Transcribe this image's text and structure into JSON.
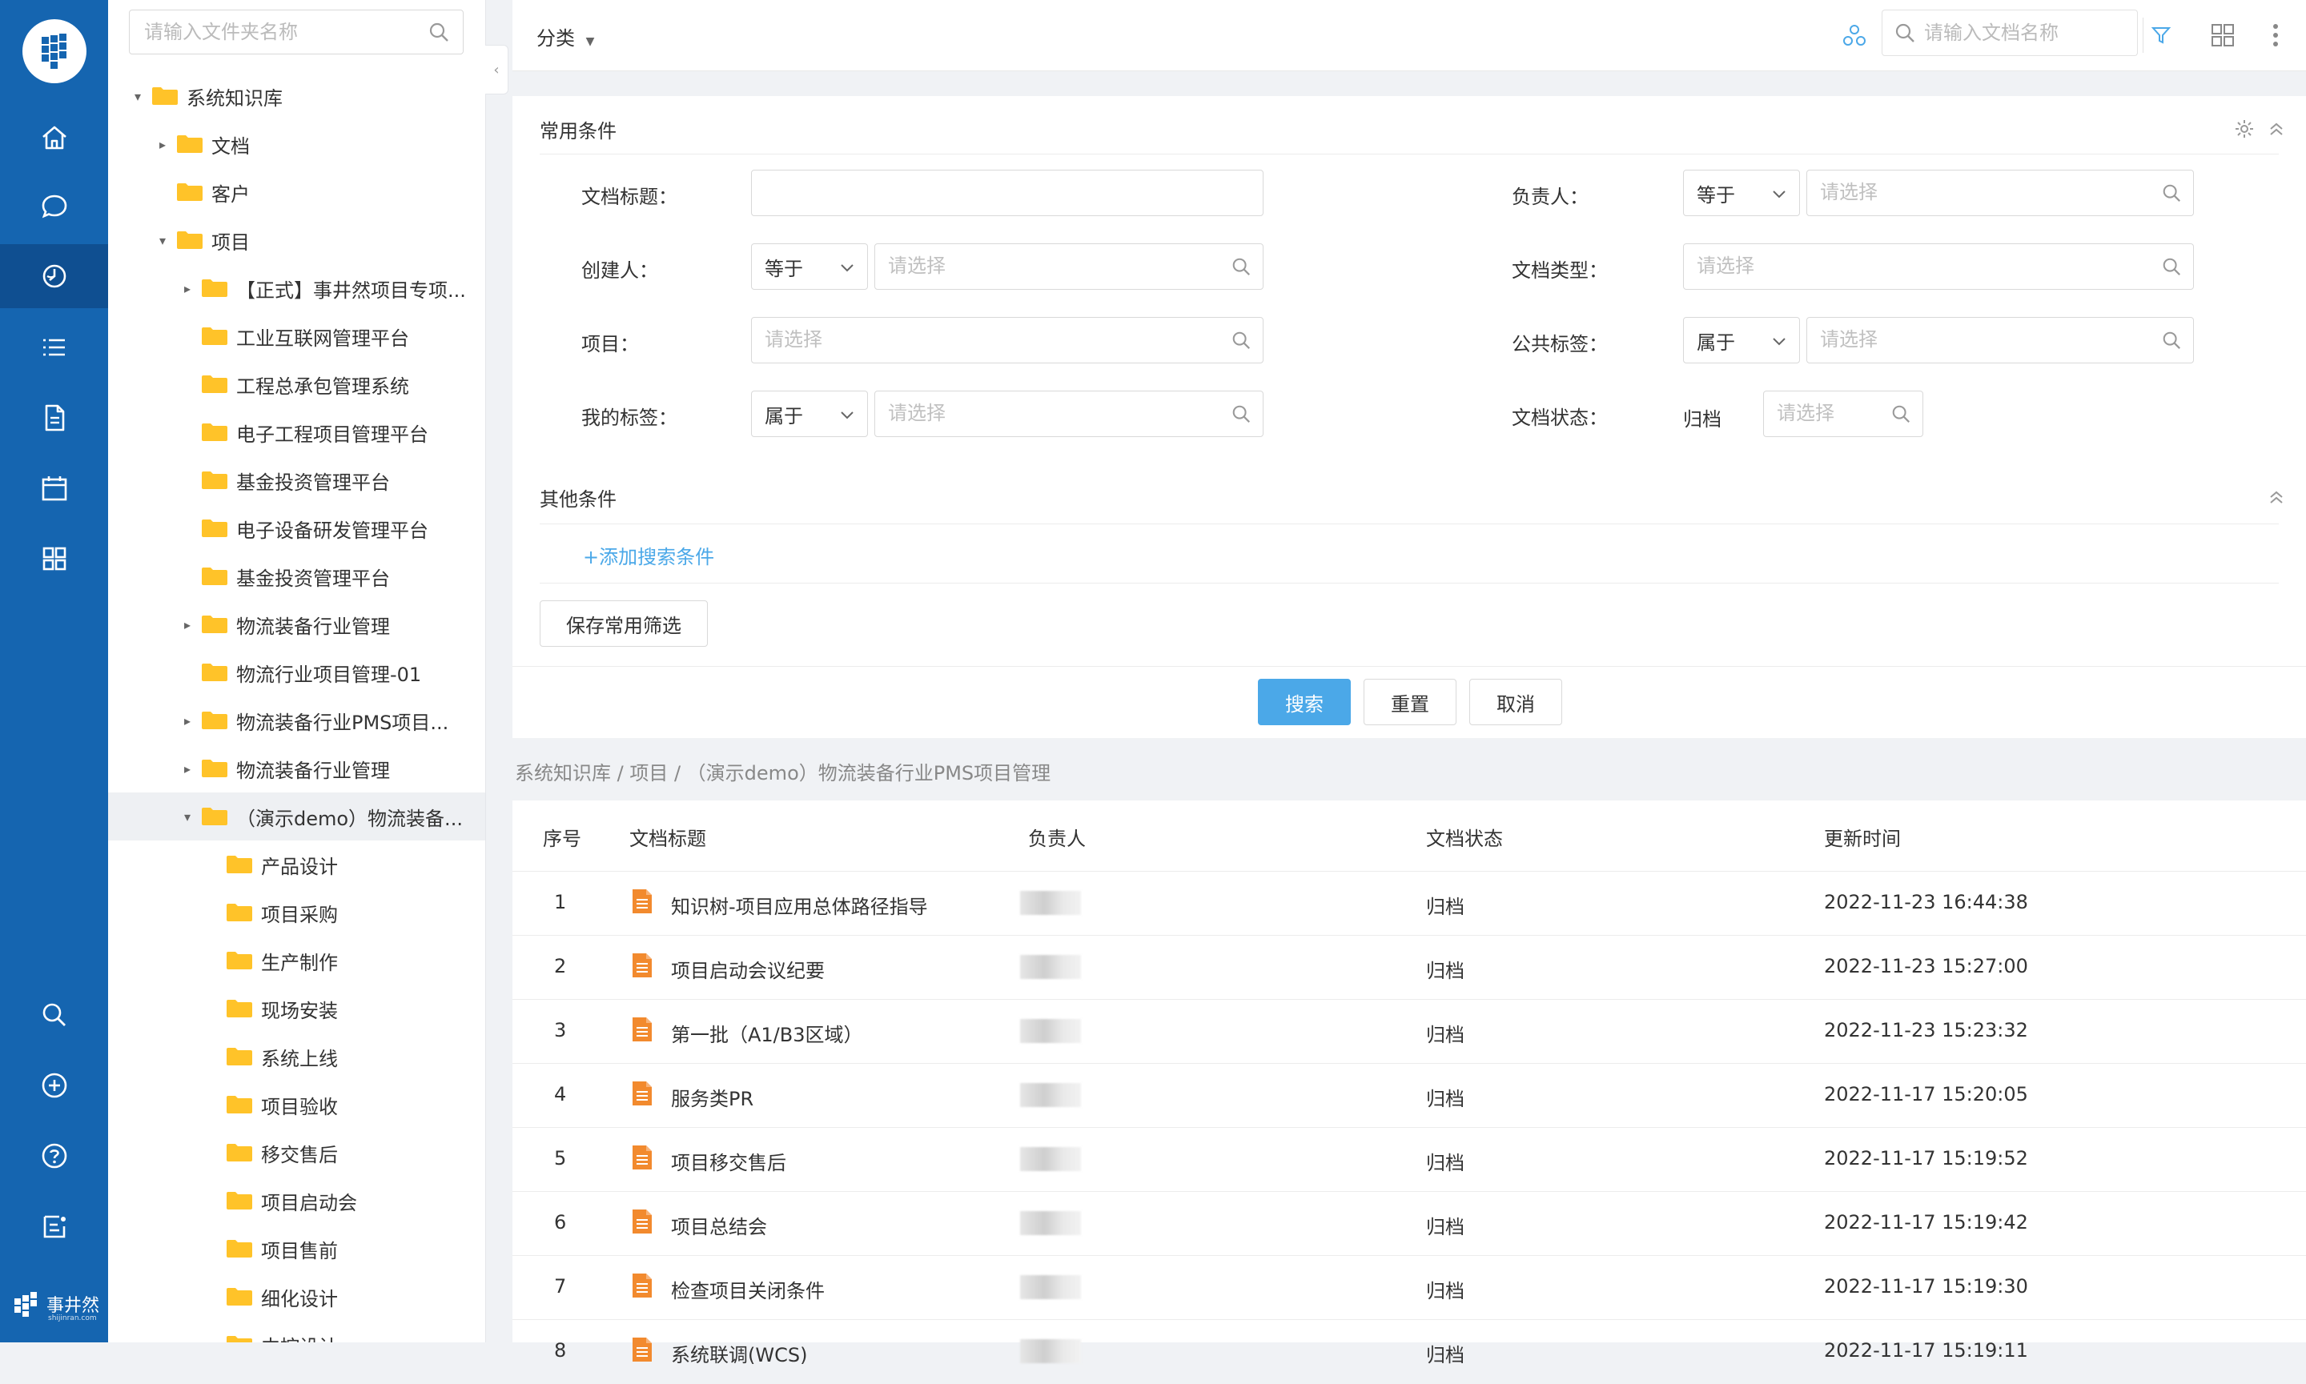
{
  "colors": {
    "rail": "#1565b0",
    "accent": "#4ba8e8",
    "folder": "#ffc329",
    "doc_icon": "#f28a2e"
  },
  "rail": {
    "items": [
      {
        "icon": "home-icon"
      },
      {
        "icon": "chat-icon"
      },
      {
        "icon": "knowledge-icon",
        "active": true
      },
      {
        "icon": "list-icon"
      },
      {
        "icon": "document-icon"
      },
      {
        "icon": "calendar-icon"
      },
      {
        "icon": "apps-icon"
      }
    ],
    "bottom_items": [
      {
        "icon": "search-icon"
      },
      {
        "icon": "add-circle-icon"
      },
      {
        "icon": "help-icon"
      },
      {
        "icon": "feedback-icon"
      }
    ],
    "brand_name": "事井然",
    "brand_sub": "shijinran.com"
  },
  "tree": {
    "search_placeholder": "请输入文件夹名称",
    "nodes": [
      {
        "label": "系统知识库",
        "caret": "▾"
      },
      {
        "label": "文档",
        "caret": "▸"
      },
      {
        "label": "客户",
        "caret": ""
      },
      {
        "label": "项目",
        "caret": "▾"
      },
      {
        "label": "【正式】事井然项目专项...",
        "caret": "▸"
      },
      {
        "label": "工业互联网管理平台",
        "caret": ""
      },
      {
        "label": "工程总承包管理系统",
        "caret": ""
      },
      {
        "label": "电子工程项目管理平台",
        "caret": ""
      },
      {
        "label": "基金投资管理平台",
        "caret": ""
      },
      {
        "label": "电子设备研发管理平台",
        "caret": ""
      },
      {
        "label": "基金投资管理平台",
        "caret": ""
      },
      {
        "label": "物流装备行业管理",
        "caret": "▸"
      },
      {
        "label": "物流行业项目管理-01",
        "caret": ""
      },
      {
        "label": "物流装备行业PMS项目...",
        "caret": "▸"
      },
      {
        "label": "物流装备行业管理",
        "caret": "▸"
      },
      {
        "label": "（演示demo）物流装备...",
        "caret": "▾"
      },
      {
        "label": "产品设计",
        "caret": ""
      },
      {
        "label": "项目采购",
        "caret": ""
      },
      {
        "label": "生产制作",
        "caret": ""
      },
      {
        "label": "现场安装",
        "caret": ""
      },
      {
        "label": "系统上线",
        "caret": ""
      },
      {
        "label": "项目验收",
        "caret": ""
      },
      {
        "label": "移交售后",
        "caret": ""
      },
      {
        "label": "项目启动会",
        "caret": ""
      },
      {
        "label": "项目售前",
        "caret": ""
      },
      {
        "label": "细化设计",
        "caret": ""
      },
      {
        "label": "中控设计",
        "caret": ""
      }
    ]
  },
  "topbar": {
    "category_label": "分类",
    "search_placeholder": "请输入文档名称"
  },
  "filter": {
    "common_title": "常用条件",
    "other_title": "其他条件",
    "add_condition": "+添加搜索条件",
    "save_filter": "保存常用筛选",
    "search_button": "搜索",
    "reset_button": "重置",
    "cancel_button": "取消",
    "select_placeholder": "请选择",
    "fields": {
      "doc_title": {
        "label": "文档标题："
      },
      "owner": {
        "label": "负责人：",
        "operator": "等于"
      },
      "creator": {
        "label": "创建人：",
        "operator": "等于"
      },
      "doc_type": {
        "label": "文档类型："
      },
      "project": {
        "label": "项目："
      },
      "public_tag": {
        "label": "公共标签：",
        "operator": "属于"
      },
      "my_tag": {
        "label": "我的标签：",
        "operator": "属于"
      },
      "doc_status": {
        "label": "文档状态：",
        "value": "归档"
      }
    }
  },
  "breadcrumb": "系统知识库 / 项目 / （演示demo）物流装备行业PMS项目管理",
  "table": {
    "headers": {
      "index": "序号",
      "title": "文档标题",
      "owner": "负责人",
      "status": "文档状态",
      "updated": "更新时间"
    },
    "rows": [
      {
        "index": "1",
        "title": "知识树-项目应用总体路径指导",
        "status": "归档",
        "updated": "2022-11-23 16:44:38"
      },
      {
        "index": "2",
        "title": "项目启动会议纪要",
        "status": "归档",
        "updated": "2022-11-23 15:27:00"
      },
      {
        "index": "3",
        "title": "第一批（A1/B3区域）",
        "status": "归档",
        "updated": "2022-11-23 15:23:32"
      },
      {
        "index": "4",
        "title": "服务类PR",
        "status": "归档",
        "updated": "2022-11-17 15:20:05"
      },
      {
        "index": "5",
        "title": "项目移交售后",
        "status": "归档",
        "updated": "2022-11-17 15:19:52"
      },
      {
        "index": "6",
        "title": "项目总结会",
        "status": "归档",
        "updated": "2022-11-17 15:19:42"
      },
      {
        "index": "7",
        "title": "检查项目关闭条件",
        "status": "归档",
        "updated": "2022-11-17 15:19:30"
      },
      {
        "index": "8",
        "title": "系统联调(WCS)",
        "status": "归档",
        "updated": "2022-11-17 15:19:11"
      }
    ]
  }
}
